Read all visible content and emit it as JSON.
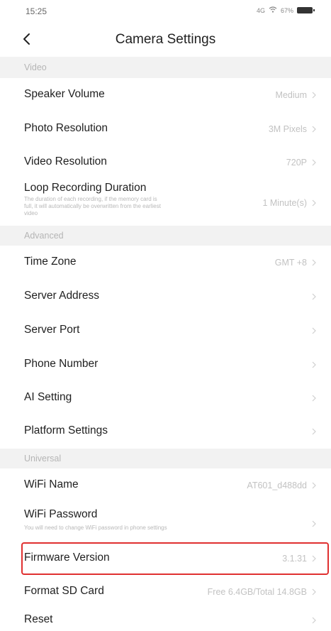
{
  "status_bar": {
    "time": "15:25",
    "signal_text": "4G",
    "battery_text": "67%"
  },
  "nav": {
    "title": "Camera Settings"
  },
  "sections": {
    "video": "Video",
    "advanced": "Advanced",
    "universal": "Universal"
  },
  "rows": {
    "speaker_volume": {
      "label": "Speaker Volume",
      "value": "Medium"
    },
    "photo_resolution": {
      "label": "Photo Resolution",
      "value": "3M Pixels"
    },
    "video_resolution": {
      "label": "Video Resolution",
      "value": "720P"
    },
    "loop_recording": {
      "label": "Loop Recording Duration",
      "description": "The duration of each recording, if the memory card is full, it will automatically be overwritten from the earliest video",
      "value": "1 Minute(s)"
    },
    "time_zone": {
      "label": "Time Zone",
      "value": "GMT +8"
    },
    "server_address": {
      "label": "Server Address",
      "value": ""
    },
    "server_port": {
      "label": "Server Port",
      "value": ""
    },
    "phone_number": {
      "label": "Phone Number",
      "value": ""
    },
    "ai_setting": {
      "label": "AI Setting",
      "value": ""
    },
    "platform_settings": {
      "label": "Platform Settings",
      "value": ""
    },
    "wifi_name": {
      "label": "WiFi Name",
      "value": "AT601_d488dd"
    },
    "wifi_password": {
      "label": "WiFi Password",
      "description": "You will need to change WiFi password in phone settings",
      "value": ""
    },
    "firmware_version": {
      "label": "Firmware Version",
      "value": "3.1.31"
    },
    "format_sd_card": {
      "label": "Format SD Card",
      "value": "Free 6.4GB/Total 14.8GB"
    },
    "reset": {
      "label": "Reset",
      "value": ""
    }
  },
  "colors": {
    "highlight": "#e03030",
    "section_bg": "#f2f2f2"
  }
}
